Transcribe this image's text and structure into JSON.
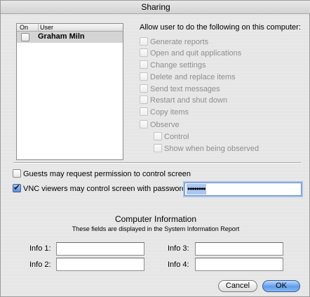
{
  "window": {
    "title": "Sharing"
  },
  "user_list": {
    "headers": {
      "on": "On",
      "user": "User"
    },
    "users": [
      {
        "on": false,
        "name": "Graham Miln"
      }
    ]
  },
  "permissions": {
    "heading": "Allow user to do the following on this computer:",
    "items": [
      {
        "label": "Generate reports",
        "checked": false
      },
      {
        "label": "Open and quit applications",
        "checked": false
      },
      {
        "label": "Change settings",
        "checked": false
      },
      {
        "label": "Delete and replace items",
        "checked": false
      },
      {
        "label": "Send text messages",
        "checked": false
      },
      {
        "label": "Restart and shut down",
        "checked": false
      },
      {
        "label": "Copy items",
        "checked": false
      },
      {
        "label": "Observe",
        "checked": false
      }
    ],
    "sub_items": [
      {
        "label": "Control",
        "checked": false
      },
      {
        "label": "Show when being observed",
        "checked": false
      }
    ]
  },
  "options": {
    "guests": {
      "label": "Guests may request permission to control screen",
      "checked": false
    },
    "vnc": {
      "label": "VNC viewers may control screen with password:",
      "checked": true
    },
    "password_mask": "••••••••"
  },
  "computer_info": {
    "title": "Computer Information",
    "subtitle": "These fields are displayed in the System Information Report",
    "fields": [
      {
        "label": "Info 1:",
        "value": ""
      },
      {
        "label": "Info 2:",
        "value": ""
      },
      {
        "label": "Info 3:",
        "value": ""
      },
      {
        "label": "Info 4:",
        "value": ""
      }
    ]
  },
  "buttons": {
    "cancel": "Cancel",
    "ok": "OK"
  },
  "colors": {
    "accent": "#5f9ce8",
    "selection": "#a9c7f0"
  }
}
